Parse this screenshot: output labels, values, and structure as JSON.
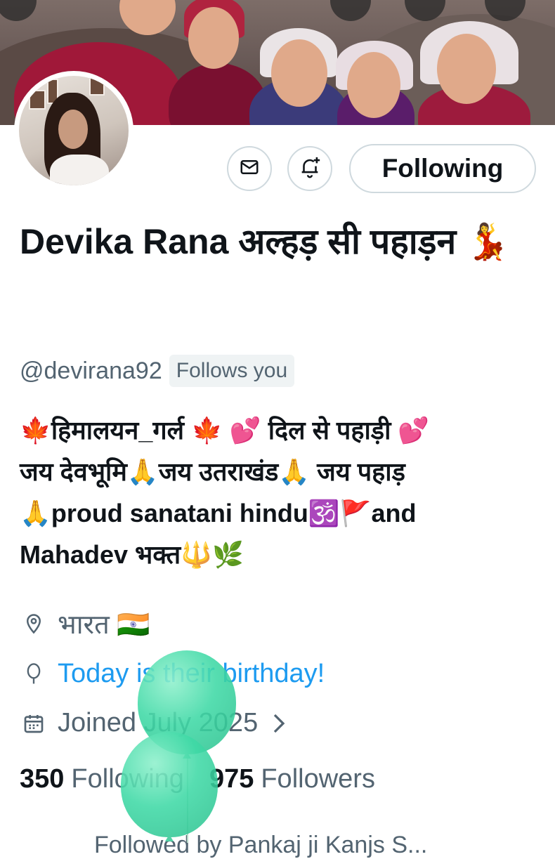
{
  "profile": {
    "display_name": "Devika Rana अल्हड़ सी पहाड़न 💃",
    "handle": "@devirana92",
    "follows_you": "Follows you",
    "bio_lines": [
      "🍁हिमालयन_गर्ल 🍁 💕 दिल से पहाड़ी 💕",
      "जय देवभूमि🙏जय उतराखंड🙏 जय पहाड़",
      "🙏proud sanatani hindu🕉️🚩and",
      "Mahadev भक्त🔱🌿"
    ],
    "location": "भारत 🇮🇳",
    "birthday_text": "Today is their birthday!",
    "joined": "Joined July 2025",
    "following_count": "350",
    "following_label": "Following",
    "followers_count": "975",
    "followers_label": "Followers",
    "followed_by": "Followed by Pankaj ji Kanjs S..."
  },
  "actions": {
    "message_icon": "mail-icon",
    "notify_icon": "bell-plus-icon",
    "follow_label": "Following"
  },
  "colors": {
    "link": "#1d9bf0",
    "secondary_text": "#536471",
    "border": "#cfd9de",
    "balloon": "#3fd9a6"
  }
}
